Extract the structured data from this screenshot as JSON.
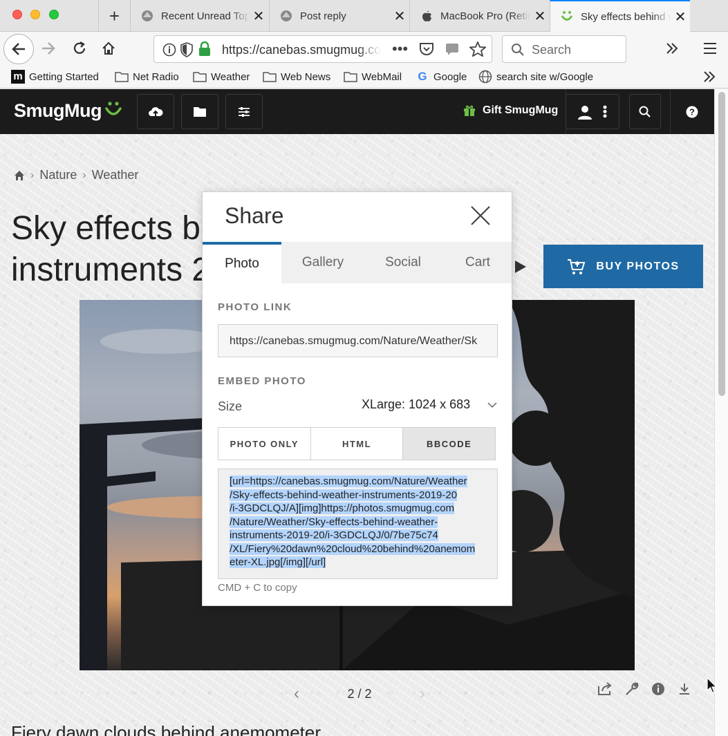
{
  "browser": {
    "tabs": [
      {
        "title": "Recent Unread Topics",
        "icon": "macrumors-icon"
      },
      {
        "title": "Post reply",
        "icon": "macrumors-icon"
      },
      {
        "title": "MacBook Pro (Retina",
        "icon": "apple-icon"
      },
      {
        "title": "Sky effects behind weather",
        "icon": "smugmug-icon",
        "active": true
      }
    ],
    "url": "https://canebas.smugmug.com",
    "search_placeholder": "Search",
    "bookmarks": [
      {
        "label": "Getting Started",
        "icon": "mozilla-icon"
      },
      {
        "label": "Net Radio",
        "icon": "folder-icon"
      },
      {
        "label": "Weather",
        "icon": "folder-icon"
      },
      {
        "label": "Web News",
        "icon": "folder-icon"
      },
      {
        "label": "WebMail",
        "icon": "folder-icon"
      },
      {
        "label": "Google",
        "icon": "google-icon"
      },
      {
        "label": "search site w/Google",
        "icon": "globe-icon"
      }
    ]
  },
  "smugmug": {
    "logo": "SmugMug",
    "gift_label": "Gift SmugMug",
    "breadcrumb": [
      "Nature",
      "Weather"
    ],
    "title_line1": "Sky effects be",
    "title_line2": "instruments 2",
    "buy_label": "BUY PHOTOS",
    "pager": "2 / 2",
    "caption": "Fiery dawn clouds behind anemometer",
    "colors": {
      "header": "#1b1b1b",
      "accent": "#1f6aa5",
      "logo_green": "#6dbe45"
    }
  },
  "share": {
    "title": "Share",
    "tabs": [
      "Photo",
      "Gallery",
      "Social",
      "Cart"
    ],
    "active_tab": "Photo",
    "photo_link_label": "PHOTO LINK",
    "photo_link": "https://canebas.smugmug.com/Nature/Weather/Sk",
    "embed_label": "EMBED PHOTO",
    "size_label": "Size",
    "size_value": "XLarge: 1024 x 683",
    "embed_tabs": [
      "PHOTO ONLY",
      "HTML",
      "BBCODE"
    ],
    "active_embed": "BBCODE",
    "code_lines": [
      "[url=https://canebas.smugmug.com/Nature/Weather",
      "/Sky-effects-behind-weather-instruments-2019-20",
      "/i-3GDCLQJ/A][img]https://photos.smugmug.com",
      "/Nature/Weather/Sky-effects-behind-weather-",
      "instruments-2019-20/i-3GDCLQJ/0/7be75c74",
      "/XL/Fiery%20dawn%20cloud%20behind%20anemom",
      "eter-XL.jpg[/img][/url]"
    ],
    "copy_hint": "CMD + C to copy"
  }
}
